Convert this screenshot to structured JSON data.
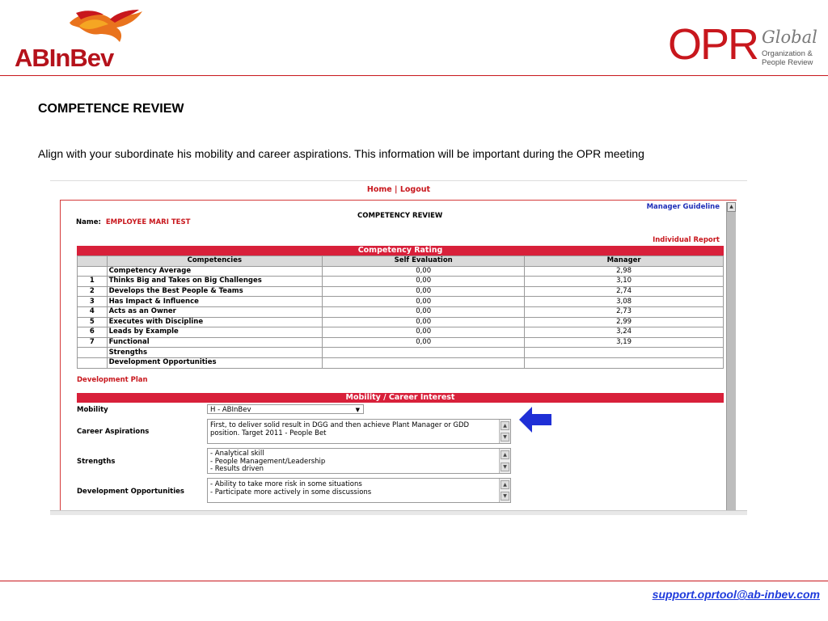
{
  "header": {
    "abinbev_logo": {
      "icon": "eagle-icon",
      "part1": "AB",
      "part2": "InBev"
    },
    "opr_logo": {
      "big": "OPR",
      "global": "Global",
      "sub_line1": "Organization &",
      "sub_line2": "People Review"
    }
  },
  "slide": {
    "title": "COMPETENCE REVIEW",
    "subtitle": "Align with your subordinate his mobility and career aspirations. This information will be important during the OPR meeting"
  },
  "app": {
    "nav": {
      "home": "Home",
      "sep": " | ",
      "logout": "Logout"
    },
    "form_title": "COMPETENCY REVIEW",
    "manager_guideline": "Manager Guideline",
    "individual_report": "Individual Report",
    "name_label": "Name:",
    "name_value": "EMPLOYEE MARI TEST",
    "competency_band": "Competency Rating",
    "table": {
      "headers": [
        "",
        "Competencies",
        "Self Evaluation",
        "Manager"
      ],
      "rows": [
        {
          "num": "",
          "name": "Competency Average",
          "self": "0,00",
          "manager": "2,98"
        },
        {
          "num": "1",
          "name": "Thinks Big and Takes on Big Challenges",
          "self": "0,00",
          "manager": "3,10"
        },
        {
          "num": "2",
          "name": "Develops the Best People & Teams",
          "self": "0,00",
          "manager": "2,74"
        },
        {
          "num": "3",
          "name": "Has Impact & Influence",
          "self": "0,00",
          "manager": "3,08"
        },
        {
          "num": "4",
          "name": "Acts as an Owner",
          "self": "0,00",
          "manager": "2,73"
        },
        {
          "num": "5",
          "name": "Executes with Discipline",
          "self": "0,00",
          "manager": "2,99"
        },
        {
          "num": "6",
          "name": "Leads by Example",
          "self": "0,00",
          "manager": "3,24"
        },
        {
          "num": "7",
          "name": "Functional",
          "self": "0,00",
          "manager": "3,19"
        },
        {
          "num": "",
          "name": "Strengths",
          "self": "",
          "manager": ""
        },
        {
          "num": "",
          "name": "Development Opportunities",
          "self": "",
          "manager": ""
        }
      ]
    },
    "development_plan": "Development Plan",
    "mobility_band": "Mobility / Career Interest",
    "mobility_label": "Mobility",
    "mobility_value": "H - ABInBev",
    "career_label": "Career Aspirations",
    "career_lines": [
      "First, to deliver solid result in DGG and then achieve Plant Manager or GDD",
      "position. Target 2011 - People Bet"
    ],
    "strengths_label": "Strengths",
    "strengths_lines": [
      "- Analytical skill",
      "- People Management/Leadership",
      "- Results driven"
    ],
    "devopp_label": "Development Opportunities",
    "devopp_lines": [
      "- Ability to take more risk in some situations",
      "- Participate more actively in some discussions"
    ]
  },
  "callout": {
    "icon": "arrow-left-icon",
    "color": "#1f2fd6"
  },
  "footer": {
    "support_email": "support.oprtool@ab-inbev.com"
  },
  "colors": {
    "brand_red": "#c8171d",
    "band_red": "#d8203a",
    "link_blue": "#1f3bdc"
  }
}
